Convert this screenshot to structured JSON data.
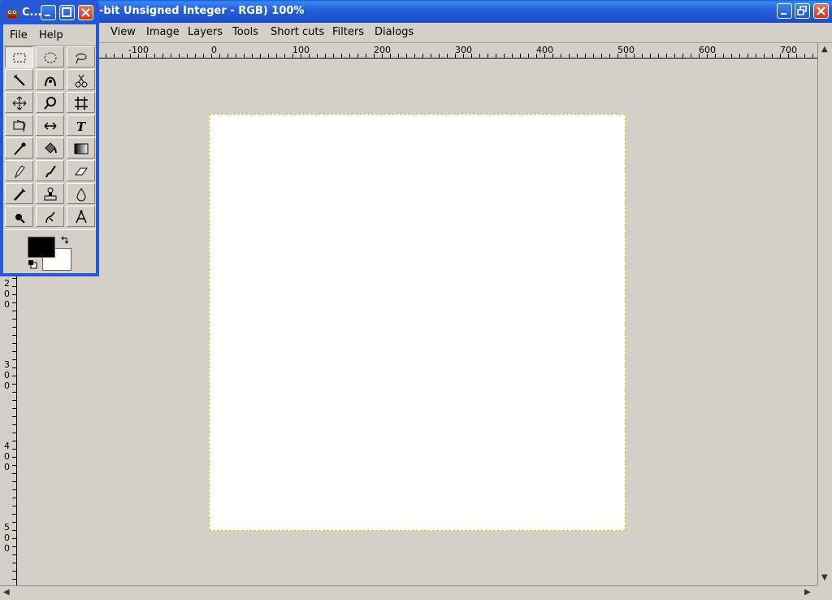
{
  "main_window": {
    "title": "-bit Unsigned Integer - RGB) 100%"
  },
  "menubar": {
    "items": [
      "View",
      "Image",
      "Layers",
      "Tools",
      "Short cuts",
      "Filters",
      "Dialogs"
    ]
  },
  "hruler": {
    "labels": [
      "-100",
      "0",
      "100",
      "200",
      "300",
      "400",
      "500",
      "600",
      "700"
    ]
  },
  "vruler": {
    "labels": [
      "200",
      "300",
      "400",
      "500"
    ]
  },
  "toolbox": {
    "title": "C...",
    "menu": [
      "File",
      "Help"
    ],
    "tools": [
      "rect-select",
      "ellipse-select",
      "free-select",
      "fuzzy-select",
      "bezier-select",
      "scissors-select",
      "move",
      "zoom",
      "crop",
      "transform",
      "flip",
      "text",
      "color-picker",
      "bucket-fill",
      "gradient",
      "pencil",
      "paintbrush",
      "eraser",
      "airbrush",
      "clone",
      "blur",
      "ink",
      "smudge",
      "measure"
    ],
    "active_tool": "rect-select",
    "fg_color": "#000000",
    "bg_color": "#ffffff"
  }
}
